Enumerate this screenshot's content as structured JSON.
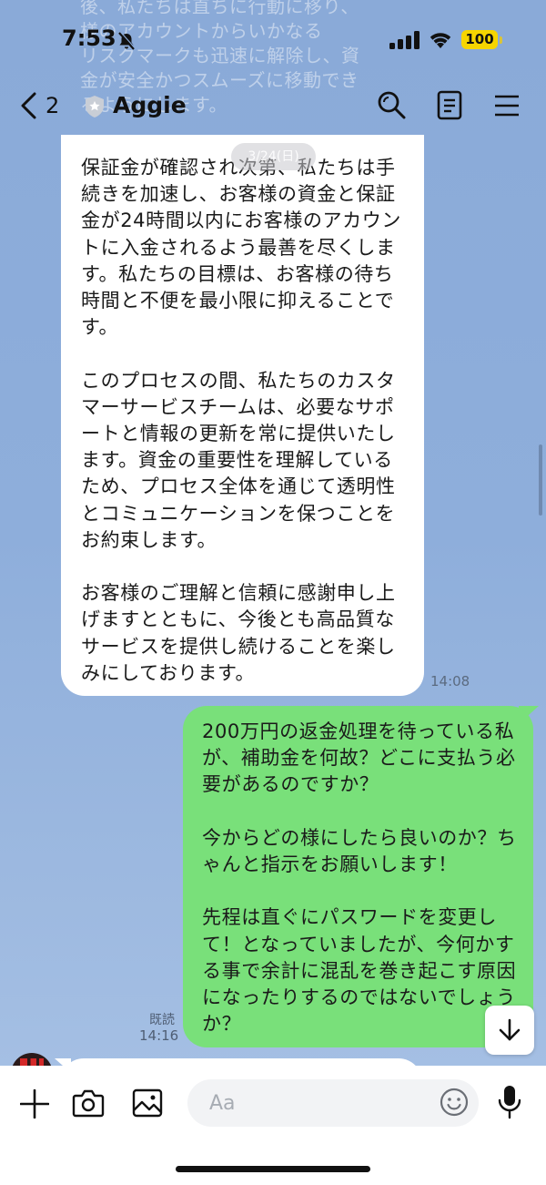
{
  "status": {
    "time": "7:53",
    "battery": "100"
  },
  "background_text": "後、私たちは直ちに行動に移り、\n様のアカウントからいかなる\nリスクマークも迅速に解除し、資\n金が安全かつスムーズに移動でき\nるようにします。",
  "header": {
    "unread_count": "2",
    "chat_name": "Aggie"
  },
  "date_pill": "3/24(日)",
  "messages": {
    "incoming": {
      "text": "保証金が確認され次第、私たちは手続きを加速し、お客様の資金と保証金が24時間以内にお客様のアカウントに入金されるよう最善を尽くします。私たちの目標は、お客様の待ち時間と不便を最小限に抑えることです。\n\nこのプロセスの間、私たちのカスタマーサービスチームは、必要なサポートと情報の更新を常に提供いたします。資金の重要性を理解しているため、プロセス全体を通じて透明性とコミュニケーションを保つことをお約束します。\n\nお客様のご理解と信頼に感謝申し上げますとともに、今後とも高品質なサービスを提供し続けることを楽しみにしております。",
      "time": "14:08"
    },
    "outgoing": {
      "text": "200万円の返金処理を待っている私が、補助金を何故？どこに支払う必要があるのですか？\n\n今からどの様にしたら良いのか？ちゃんと指示をお願いします！\n\n先程は直ぐにパスワードを変更して！となっていましたが、今何かする事で余計に混乱を巻き起こす原因になったりするのではないでしょうか？",
      "read_label": "既読",
      "time": "14:16"
    }
  },
  "input": {
    "placeholder": "Aa"
  },
  "colors": {
    "outgoing_bubble": "#79e07a",
    "incoming_bubble": "#ffffff",
    "battery": "#f6d500"
  },
  "icons": [
    "bell-slash-icon",
    "signal-icon",
    "wifi-icon",
    "back-chevron-icon",
    "shield-icon",
    "search-icon",
    "notes-icon",
    "menu-icon",
    "arrow-down-icon",
    "plus-icon",
    "camera-icon",
    "image-icon",
    "emoji-icon",
    "mic-icon"
  ]
}
